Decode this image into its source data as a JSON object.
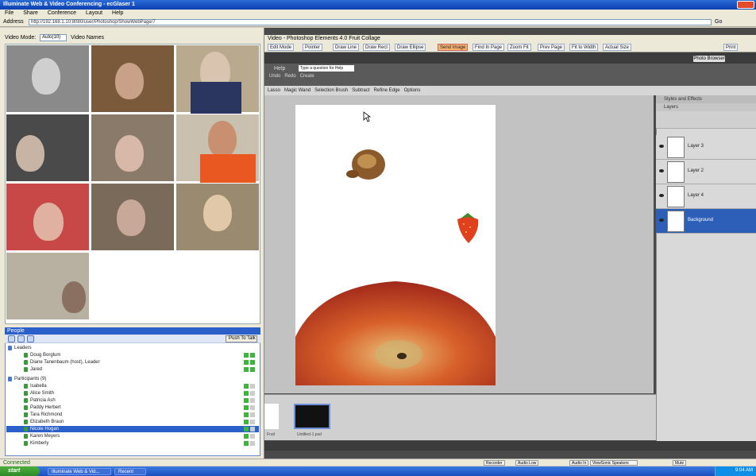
{
  "window": {
    "title": "Illuminate Web & Video Conferencing - ecGlaser 1",
    "menu": [
      "File",
      "Share",
      "Conference",
      "Layout",
      "Help"
    ]
  },
  "address": {
    "label": "Address",
    "value": "http://192.168.1.10:8080/user/Photoshop/ShowWebPage/7",
    "go": "Go"
  },
  "video": {
    "label": "Video Mode:",
    "mode": "Auto(10)",
    "option": "Video Names"
  },
  "people": {
    "header": "People",
    "talk_button": "Push To Talk",
    "groups": [
      {
        "name": "Leaders",
        "members": [
          "Doug Borglum",
          "Diane Tanenbaum (host), Leader",
          "Jared"
        ]
      },
      {
        "name": "Participants (9)",
        "members": [
          "Isabella",
          "Alice Smith",
          "Patricia Ash",
          "Paddy Herbert",
          "Tara Richmond",
          "Elizabeth Braun",
          "Nicole Hogan",
          "Karen Meyers",
          "Kimberly"
        ]
      }
    ],
    "selected": "Nicole Hogan"
  },
  "status_left": "Connected",
  "share": {
    "title": "Video - Photoshop Elements 4.0 Fruit Collage",
    "toolbar": [
      "Edit Mode",
      "Pointer",
      "Draw Line",
      "Draw Rect",
      "Draw Ellipse",
      "Send Image",
      "Find In Page",
      "Zoom Fit",
      "Prev Page",
      "Fit to Width",
      "Actual Size",
      "Print"
    ],
    "active_tool": "Send Image",
    "ps_button": "Photo Browser",
    "search_label": "Help",
    "search_placeholder": "Type a question for Help",
    "ps_row": [
      "Undo",
      "Redo",
      "Create"
    ],
    "options_bar": [
      "Lasso",
      "Magic Wand",
      "Selection Brush",
      "Subtract",
      "Refine Edge",
      "Options"
    ]
  },
  "layers": {
    "header": "Layers",
    "subheader": "Styles and Effects",
    "items": [
      {
        "name": "Layer 3",
        "active": false
      },
      {
        "name": "Layer 2",
        "active": false
      },
      {
        "name": "Layer 4",
        "active": false
      },
      {
        "name": "Background",
        "active": true
      }
    ]
  },
  "filmstrip": {
    "captions": [
      "Fruit",
      "Untitled-1.psd"
    ]
  },
  "status_right": [
    "Recorder",
    "Audio Low",
    "Audio In",
    "ViewSonic Speakers",
    "Mute"
  ],
  "taskbar": {
    "start": "start",
    "tasks": [
      "Illuminate Web & Vid...",
      "Recent"
    ],
    "clock": "9:04 AM"
  },
  "colors": {
    "xp_blue": "#2b5fc9",
    "ps_dark": "#3c3c3c",
    "active_tool": "#f7b36a",
    "active_layer": "#2d5fb8"
  }
}
